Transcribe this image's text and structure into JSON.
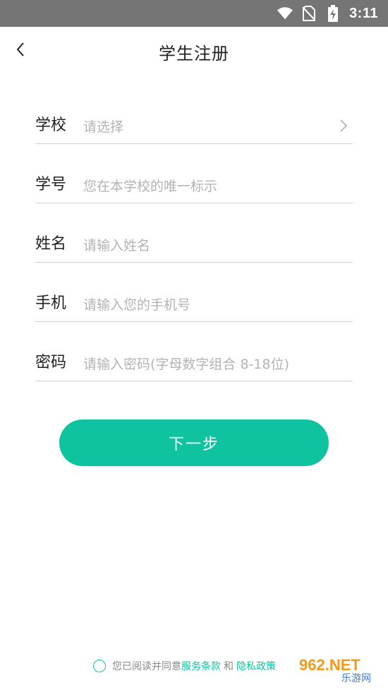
{
  "status_bar": {
    "time": "3:11",
    "icons": [
      "wifi-icon",
      "no-sim-icon",
      "battery-charging-icon"
    ]
  },
  "header": {
    "title": "学生注册",
    "back_icon": "chevron-left-icon"
  },
  "form": {
    "school": {
      "label": "学校",
      "placeholder": "请选择",
      "value": ""
    },
    "student_id": {
      "label": "学号",
      "placeholder": "您在本学校的唯一标示",
      "value": ""
    },
    "name": {
      "label": "姓名",
      "placeholder": "请输入姓名",
      "value": ""
    },
    "phone": {
      "label": "手机",
      "placeholder": "请输入您的手机号",
      "value": ""
    },
    "password": {
      "label": "密码",
      "placeholder": "请输入密码(字母数字组合 8-18位)",
      "value": ""
    }
  },
  "next_button": {
    "label": "下一步"
  },
  "agreement": {
    "prefix": "您已阅读并同意",
    "terms_link": "服务条款",
    "and": "和",
    "privacy_link": "隐私政策",
    "checked": false
  },
  "watermark": {
    "text_top": "962.NET",
    "text_bottom": "乐游网"
  },
  "colors": {
    "accent": "#10c3a0",
    "status_bar": "#757575",
    "divider": "#cfcfcf",
    "placeholder": "#b3b3b3"
  }
}
